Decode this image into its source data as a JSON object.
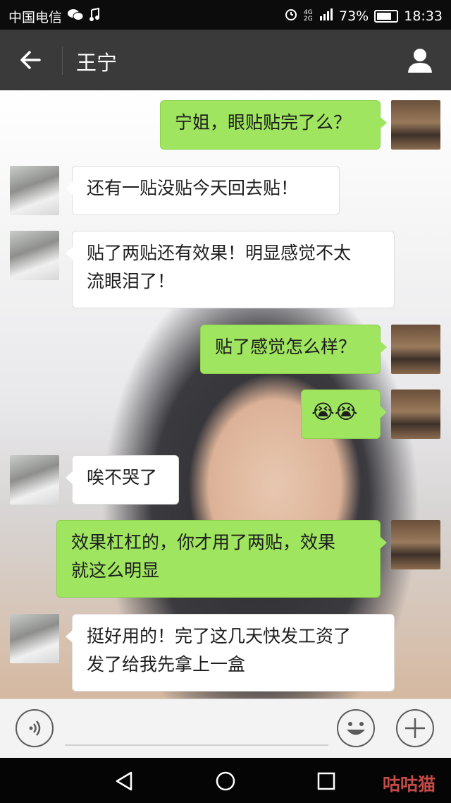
{
  "status_bar": {
    "carrier": "中国电信",
    "network": "4G 2G",
    "battery": "73%",
    "time": "18:33",
    "icons": [
      "wechat-icon",
      "music-icon",
      "alarm-icon",
      "signal-icon",
      "battery-icon"
    ]
  },
  "header": {
    "title": "王宁",
    "icons": [
      "back-arrow-icon",
      "profile-icon"
    ]
  },
  "messages": [
    {
      "sender": "me",
      "text": "宁姐，眼贴贴完了么？"
    },
    {
      "sender": "friend",
      "text": "还有一贴没贴今天回去贴！"
    },
    {
      "sender": "friend",
      "text": "贴了两贴还有效果！明显感觉不太\n流眼泪了！"
    },
    {
      "sender": "me",
      "text": "贴了感觉怎么样？"
    },
    {
      "sender": "me",
      "text": "😭😭"
    },
    {
      "sender": "friend",
      "text": "唉不哭了"
    },
    {
      "sender": "me",
      "text": "效果杠杠的，你才用了两贴，效果\n就这么明显"
    },
    {
      "sender": "friend",
      "text": "挺好用的！完了这几天快发工资了\n发了给我先拿上一盒"
    }
  ],
  "input_bar": {
    "placeholder": "",
    "icons": [
      "voice-icon",
      "emoji-icon",
      "plus-icon"
    ]
  },
  "nav_bar": {
    "icons": [
      "nav-back-icon",
      "nav-home-icon",
      "nav-recent-icon"
    ],
    "watermark": "咕咕猫"
  },
  "colors": {
    "my_bubble": "#9fe55f",
    "friend_bubble": "#ffffff",
    "title_bar": "#3a3a3a",
    "watermark": "#c24a48"
  }
}
